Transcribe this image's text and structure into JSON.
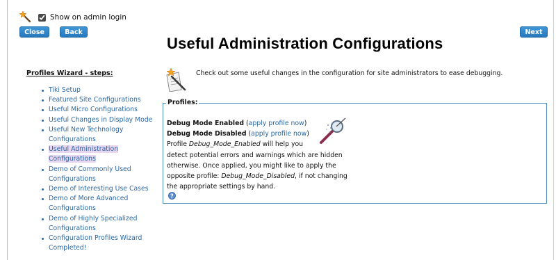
{
  "header": {
    "checkbox_label": "Show on admin login",
    "checkbox_checked": true
  },
  "buttons": {
    "close": "Close",
    "back": "Back",
    "next": "Next"
  },
  "page_title": "Useful Administration Configurations",
  "sidebar": {
    "heading": "Profiles Wizard - steps:",
    "items": [
      {
        "label": "Tiki Setup",
        "current": false
      },
      {
        "label": "Featured Site Configurations",
        "current": false
      },
      {
        "label": "Useful Micro Configurations",
        "current": false
      },
      {
        "label": "Useful Changes in Display Mode",
        "current": false
      },
      {
        "label": "Useful New Technology Configurations",
        "current": false
      },
      {
        "label": "Useful Administration Configurations",
        "current": true
      },
      {
        "label": "Demo of Commonly Used Configurations",
        "current": false
      },
      {
        "label": "Demo of Interesting Use Cases",
        "current": false
      },
      {
        "label": "Demo of More Advanced Configurations",
        "current": false
      },
      {
        "label": "Demo of Highly Specialized Configurations",
        "current": false
      },
      {
        "label": "Configuration Profiles Wizard Completed!",
        "current": false
      }
    ]
  },
  "intro": "Check out some useful changes in the configuration for site administrators to ease debugging.",
  "profiles": {
    "legend": "Profiles:",
    "enabled_label": "Debug Mode Enabled",
    "enabled_link": "apply profile now",
    "disabled_label": "Debug Mode Disabled",
    "disabled_link": "apply profile now",
    "desc_prefix": "Profile ",
    "desc_profile": "Debug_Mode_Enabled",
    "desc_part1": " will help you",
    "desc_line2": "detect potential errors and warnings which are hidden",
    "desc_line3": "otherwise. Once applied, you might like to apply the",
    "desc_line4_prefix": "opposite profile: ",
    "desc_profile2": "Debug_Mode_Disabled",
    "desc_line4_suffix": ", if not changing",
    "desc_line5": "the appropriate settings by hand."
  },
  "colors": {
    "accent": "#2778bd",
    "link": "#2a69a6",
    "highlight": "#e6d6ef",
    "box_border": "#4f8fc0"
  }
}
